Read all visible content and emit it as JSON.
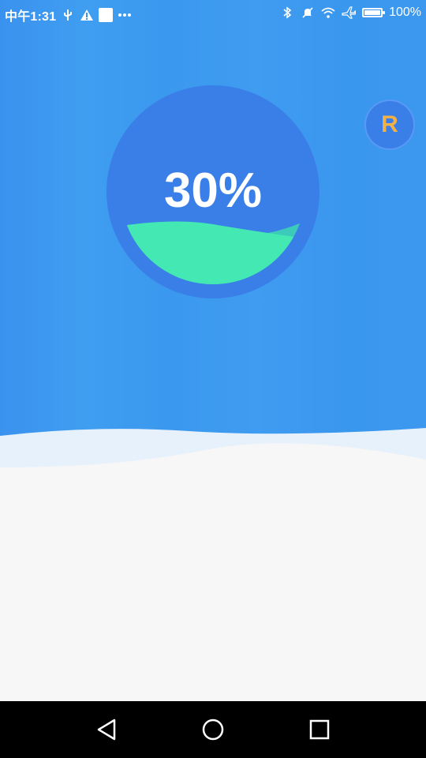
{
  "status_bar": {
    "time": "中午1:31",
    "battery_percent": "100%",
    "icons_left": [
      "usb-icon",
      "warning-icon",
      "notification-square-icon",
      "more-icon"
    ],
    "icons_right": [
      "bluetooth-icon",
      "mute-icon",
      "wifi-icon",
      "airplane-icon",
      "battery-icon"
    ]
  },
  "gauge": {
    "value_text": "30%",
    "level_fraction": 0.3,
    "fill_color": "#44e8b2",
    "circle_color": "#3a7fe8"
  },
  "floating_button": {
    "label": "R",
    "icon": "r-logo-icon"
  },
  "nav_bar": {
    "icons": [
      "back-triangle-icon",
      "home-circle-icon",
      "recent-square-icon"
    ]
  }
}
